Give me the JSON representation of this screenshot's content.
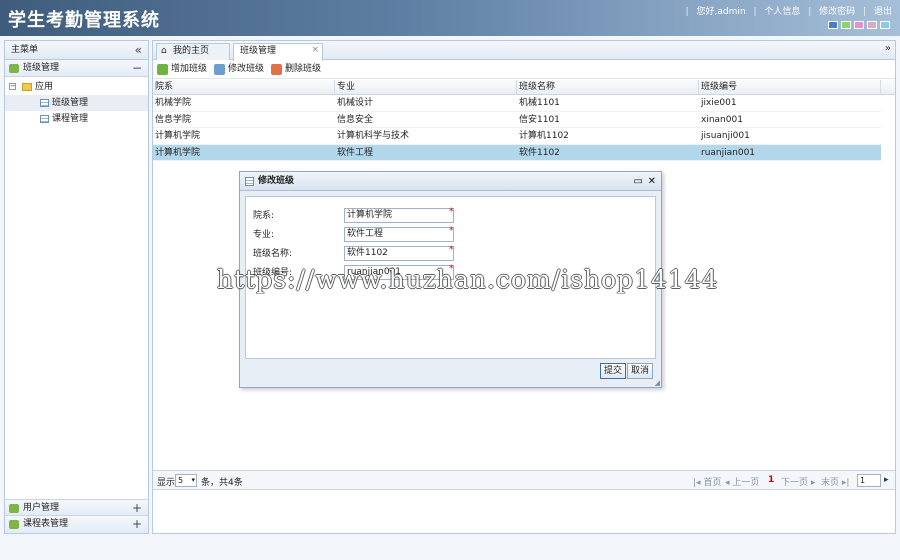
{
  "header": {
    "title": "学生考勤管理系统",
    "greeting": "您好,admin",
    "links": [
      "个人信息",
      "修改密码",
      "退出"
    ],
    "theme_colors": [
      "#4a7fc1",
      "#8fd46a",
      "#e58ed9",
      "#d9a9c9",
      "#8cc8e8"
    ]
  },
  "sidebar": {
    "title": "主菜单",
    "collapse_icon": "double-chevron-left-icon",
    "sections": [
      {
        "label": "班级管理",
        "toggle": "−"
      },
      {
        "label": "用户管理",
        "toggle": "+"
      },
      {
        "label": "课程表管理",
        "toggle": "+"
      }
    ],
    "tree": {
      "folder": "应用",
      "items": [
        "班级管理",
        "课程管理"
      ]
    }
  },
  "tabs": [
    {
      "label": "我的主页"
    },
    {
      "label": "班级管理",
      "close": "×"
    }
  ],
  "toolbar": {
    "add": "增加班级",
    "edit": "修改班级",
    "delete": "删除班级"
  },
  "grid": {
    "columns": [
      "院系",
      "专业",
      "班级名称",
      "班级编号"
    ],
    "rows": [
      [
        "机械学院",
        "机械设计",
        "机械1101",
        "jixie001"
      ],
      [
        "信息学院",
        "信息安全",
        "信安1101",
        "xinan001"
      ],
      [
        "计算机学院",
        "计算机科学与技术",
        "计算机1102",
        "jisuanji001"
      ],
      [
        "计算机学院",
        "软件工程",
        "软件1102",
        "ruanjian001"
      ]
    ],
    "selected_row": 3
  },
  "pager": {
    "show": "显示",
    "page_size": "5",
    "summary": "条，共4条",
    "first": "首页",
    "prev": "上一页",
    "current": "1",
    "next": "下一页",
    "last": "末页",
    "page_input": "1"
  },
  "dialog": {
    "title": "修改班级",
    "fields": [
      {
        "label": "院系:",
        "value": "计算机学院"
      },
      {
        "label": "专业:",
        "value": "软件工程"
      },
      {
        "label": "班级名称:",
        "value": "软件1102"
      },
      {
        "label": "班级编号:",
        "value": "ruanjian001"
      }
    ],
    "required_mark": "*",
    "submit": "提交",
    "cancel": "取消"
  },
  "watermark": "https://www.huzhan.com/ishop14144"
}
